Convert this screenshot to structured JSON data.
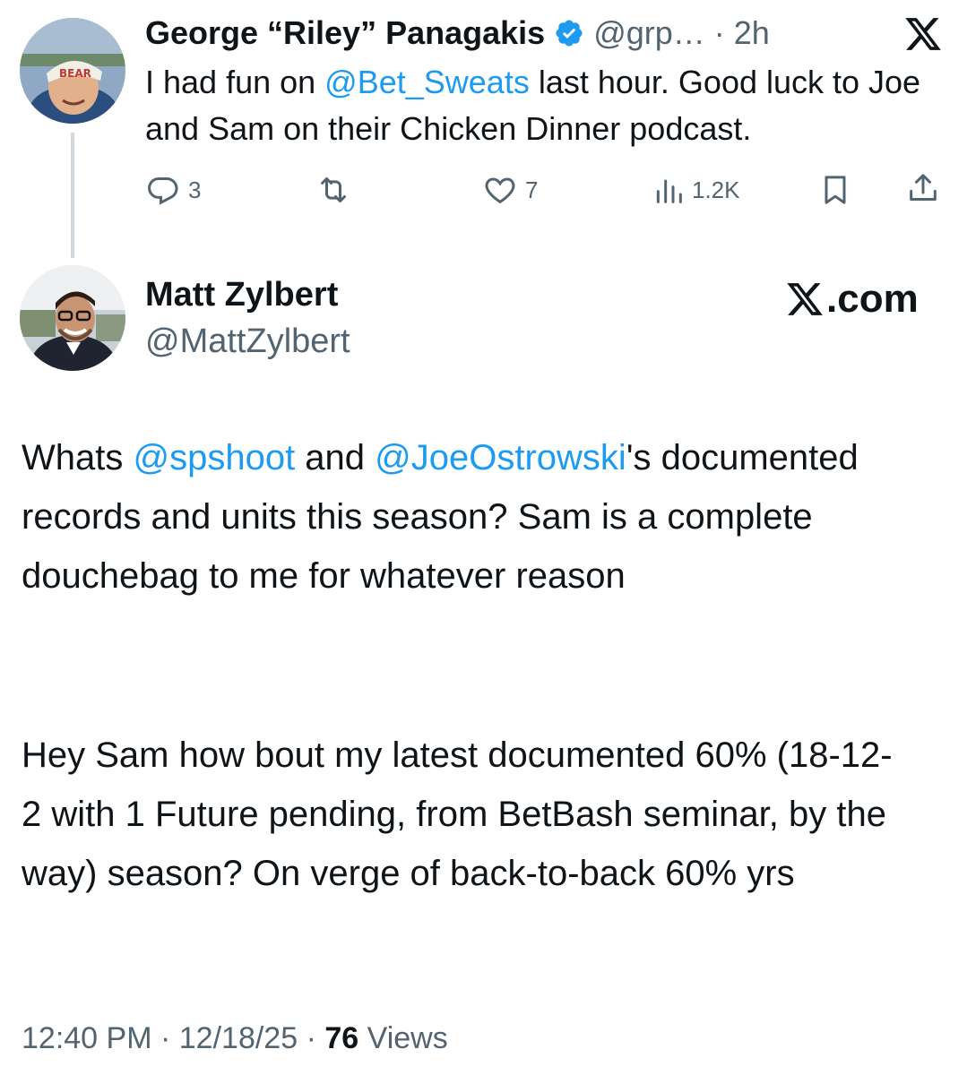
{
  "parent_tweet": {
    "display_name": "George “Riley” Panagakis",
    "handle": "@grp…",
    "separator": "·",
    "time_ago": "2h",
    "text_parts": [
      "I had fun on ",
      "@Bet_Sweats",
      " last hour. Good luck to Joe and Sam on their Chicken Dinner podcast."
    ],
    "metrics": {
      "replies": "3",
      "likes": "7",
      "views": "1.2K"
    },
    "avatar_icon": "avatar-photo-icon",
    "verified_icon": "verified-badge-icon",
    "logo_icon": "x-logo-icon"
  },
  "main_tweet": {
    "display_name": "Matt Zylbert",
    "handle": "@MattZylbert",
    "brand_label": "𝕏.com",
    "paragraph1_parts": [
      "Whats ",
      "@spshoot",
      " and ",
      "@JoeOstrowski",
      "'s documented records and units this season? Sam is a complete douchebag to me for whatever reason"
    ],
    "paragraph2": "Hey Sam how bout my latest documented 60% (18-12-2 with 1 Future pending, from BetBash seminar, by the way) season? On verge of back-to-back 60% yrs",
    "footer": {
      "time": "12:40 PM",
      "sep1": "·",
      "date": "12/18/25",
      "sep2": "·",
      "views_count": "76",
      "views_label": "Views"
    }
  },
  "colors": {
    "accent": "#1d9bf0",
    "muted": "#536471",
    "text": "#0f1419",
    "thread_line": "#cfd9de"
  }
}
